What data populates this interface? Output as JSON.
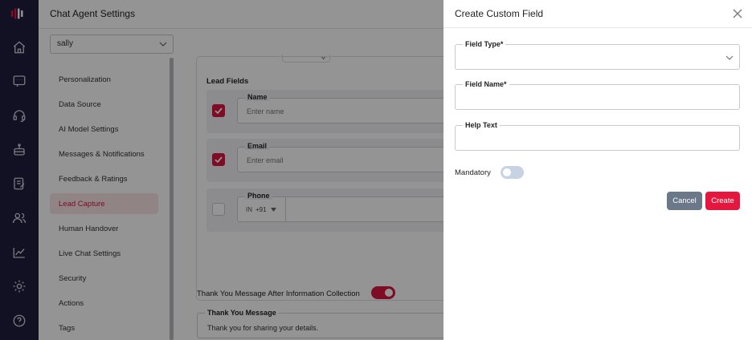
{
  "colors": {
    "rail_bg": "#1f1d3d",
    "accent": "#d8163f",
    "create_button": "#e5173f",
    "cancel_button": "#6b788a",
    "toggle_off": "#c7d3e3"
  },
  "rail": {
    "icons": [
      "logo-icon",
      "home-icon",
      "chat-icon",
      "headset-icon",
      "bot-icon",
      "notes-icon",
      "users-icon",
      "analytics-icon",
      "gear-icon",
      "help-icon"
    ]
  },
  "header": {
    "title": "Chat Agent Settings"
  },
  "agent_select": {
    "value": "sally"
  },
  "settings_nav": {
    "items": [
      {
        "label": "Personalization",
        "active": false
      },
      {
        "label": "Data Source",
        "active": false
      },
      {
        "label": "AI Model Settings",
        "active": false
      },
      {
        "label": "Messages & Notifications",
        "active": false
      },
      {
        "label": "Feedback & Ratings",
        "active": false
      },
      {
        "label": "Lead Capture",
        "active": true
      },
      {
        "label": "Human Handover",
        "active": false
      },
      {
        "label": "Live Chat Settings",
        "active": false
      },
      {
        "label": "Security",
        "active": false
      },
      {
        "label": "Actions",
        "active": false
      },
      {
        "label": "Tags",
        "active": false
      }
    ]
  },
  "lead_capture": {
    "section_title": "Lead Fields",
    "fields": [
      {
        "label": "Name",
        "placeholder": "Enter name",
        "checked": true
      },
      {
        "label": "Email",
        "placeholder": "Enter email",
        "checked": true
      },
      {
        "label": "Phone",
        "country_code": "IN",
        "dial_code": "+91",
        "checked": false
      }
    ],
    "thank_you_toggle_label": "Thank You Message After Information Collection",
    "thank_you_toggle_on": true,
    "thank_you_label": "Thank You Message",
    "thank_you_value": "Thank you for sharing your details."
  },
  "drawer": {
    "title": "Create Custom Field",
    "field_type_label": "Field Type*",
    "field_type_value": "",
    "field_name_label": "Field Name*",
    "field_name_value": "",
    "help_text_label": "Help Text",
    "help_text_value": "",
    "mandatory_label": "Mandatory",
    "mandatory_on": false,
    "cancel_label": "Cancel",
    "create_label": "Create"
  }
}
